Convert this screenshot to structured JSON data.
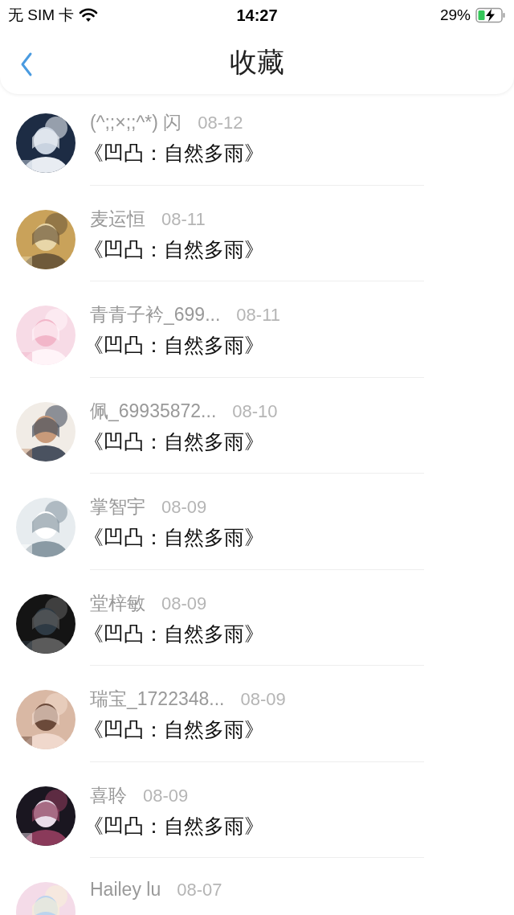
{
  "status_bar": {
    "carrier": "无 SIM 卡",
    "time": "14:27",
    "battery": "29%"
  },
  "nav_bar": {
    "title": "收藏"
  },
  "favorites": [
    {
      "name": "(^;;×;;^*) 闪",
      "date": "08-12",
      "title": "《凹凸：自然多雨》"
    },
    {
      "name": "麦运恒",
      "date": "08-11",
      "title": "《凹凸：自然多雨》"
    },
    {
      "name": "青青子衿_699...",
      "date": "08-11",
      "title": "《凹凸：自然多雨》"
    },
    {
      "name": "佩_69935872...",
      "date": "08-10",
      "title": "《凹凸：自然多雨》"
    },
    {
      "name": "掌智宇",
      "date": "08-09",
      "title": "《凹凸：自然多雨》"
    },
    {
      "name": "堂梓敏",
      "date": "08-09",
      "title": "《凹凸：自然多雨》"
    },
    {
      "name": "瑞宝_1722348...",
      "date": "08-09",
      "title": "《凹凸：自然多雨》"
    },
    {
      "name": "喜聆",
      "date": "08-09",
      "title": "《凹凸：自然多雨》"
    },
    {
      "name": "Hailey lu",
      "date": "08-07"
    }
  ]
}
